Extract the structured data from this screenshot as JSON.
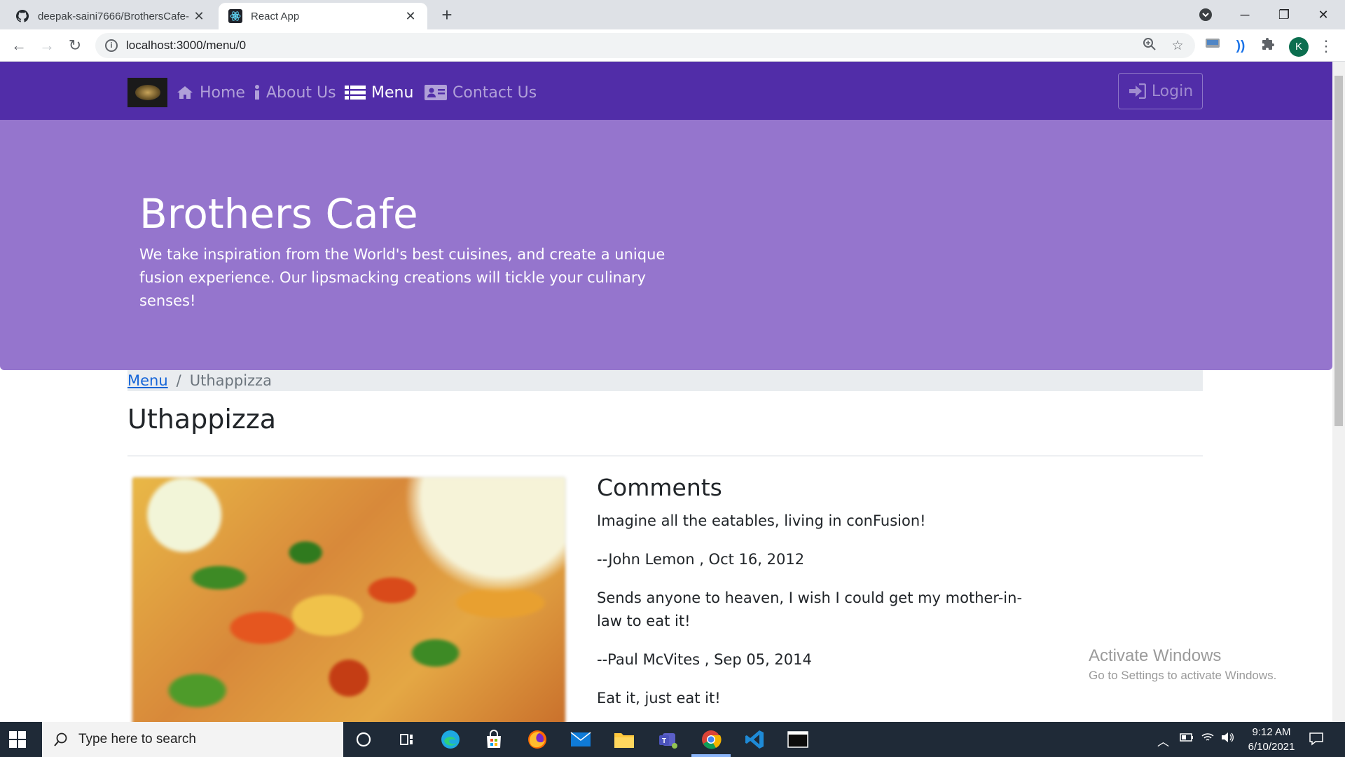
{
  "browser": {
    "tabs": [
      {
        "title": "deepak-saini7666/BrothersCafe-",
        "active": false
      },
      {
        "title": "React App",
        "active": true
      }
    ],
    "url": "localhost:3000/menu/0",
    "profile_initial": "K"
  },
  "navbar": {
    "items": [
      {
        "label": "Home",
        "icon": "home-icon",
        "active": false
      },
      {
        "label": "About Us",
        "icon": "info-icon",
        "active": false
      },
      {
        "label": "Menu",
        "icon": "list-icon",
        "active": true
      },
      {
        "label": "Contact Us",
        "icon": "address-card-icon",
        "active": false
      }
    ],
    "login_label": "Login"
  },
  "jumbotron": {
    "title": "Brothers Cafe",
    "text": "We take inspiration from the World's best cuisines, and create a unique fusion experience. Our lipsmacking creations will tickle your culinary senses!"
  },
  "breadcrumb": {
    "link": "Menu",
    "separator": "/",
    "current": "Uthappizza"
  },
  "dish": {
    "name": "Uthappizza"
  },
  "comments": {
    "heading": "Comments",
    "lines": [
      "Imagine all the eatables, living in conFusion!",
      "--John Lemon , Oct 16, 2012",
      "Sends anyone to heaven, I wish I could get my mother-in-law to eat it!",
      "--Paul McVites , Sep 05, 2014",
      "Eat it, just eat it!"
    ]
  },
  "watermark": {
    "title": "Activate Windows",
    "subtitle": "Go to Settings to activate Windows."
  },
  "taskbar": {
    "search_placeholder": "Type here to search",
    "time": "9:12 AM",
    "date": "6/10/2021"
  },
  "colors": {
    "navbar": "#512da8",
    "jumbotron": "#9575cd",
    "link": "#1565d8"
  }
}
